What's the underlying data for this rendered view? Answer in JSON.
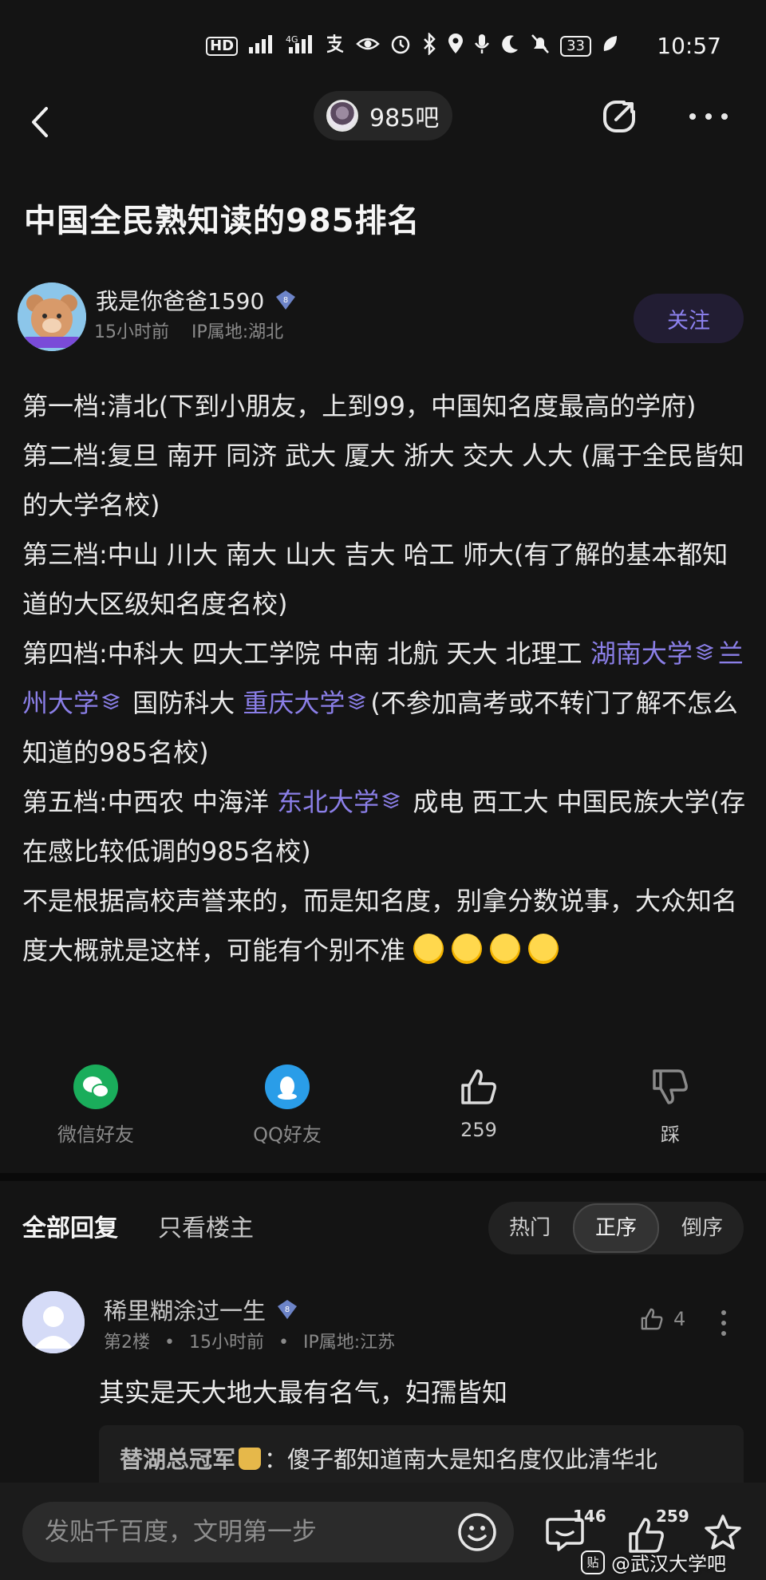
{
  "status_bar": {
    "hd_label": "HD",
    "battery": "33",
    "time": "10:57"
  },
  "nav": {
    "forum_name": "985吧"
  },
  "post": {
    "title": "中国全民熟知读的985排名",
    "author": {
      "name": "我是你爸爸1590",
      "level": "8",
      "time": "15小时前",
      "ip": "IP属地:湖北"
    },
    "follow_label": "关注",
    "body": {
      "line1": "第一档:清北(下到小朋友，上到99，中国知名度最高的学府)",
      "line2": "第二档:复旦 南开 同济 武大 厦大 浙大 交大 人大 (属于全民皆知的大学名校)",
      "line3": "第三档:中山 川大 南大 山大 吉大 哈工 师大(有了解的基本都知道的大区级知名度名校)",
      "line4_pre": "第四档:中科大 四大工学院 中南 北航 天大 北理工 ",
      "link_hunan": "湖南大学",
      "link_lanzhou": "兰州大学",
      "line4_mid": " 国防科大 ",
      "link_chongqing": "重庆大学",
      "line4_post": "(不参加高考或不转门了解不怎么知道的985名校)",
      "line5_pre": "第五档:中西农 中海洋 ",
      "link_dongbei": "东北大学",
      "line5_post": " 成电 西工大 中国民族大学(存在感比较低调的985名校)",
      "line6": "不是根据高校声誉来的，而是知名度，别拿分数说事，大众知名度大概就是这样，可能有个别不准"
    }
  },
  "actions": {
    "wechat": "微信好友",
    "qq": "QQ好友",
    "likes": "259",
    "dislike": "踩"
  },
  "replies": {
    "tab_all": "全部回复",
    "tab_op": "只看楼主",
    "sort": [
      "热门",
      "正序",
      "倒序"
    ],
    "sort_active": 1,
    "first": {
      "name": "稀里糊涂过一生",
      "level": "8",
      "floor": "第2楼",
      "time": "15小时前",
      "ip": "IP属地:江苏",
      "likes": "4",
      "text": "其实是天大地大最有名气，妇孺皆知",
      "sub_who": "替湖总冠军",
      "sub_text": "傻子都知道南大是知名度仅此清华北"
    }
  },
  "bottom_bar": {
    "placeholder": "发贴千百度，文明第一步",
    "comment_count": "146",
    "like_count": "259",
    "watermark": "@武汉大学吧",
    "watermark_logo": "贴"
  },
  "colors": {
    "link": "#8b7fe8",
    "follow": "#8d82f0",
    "background": "#141414"
  }
}
